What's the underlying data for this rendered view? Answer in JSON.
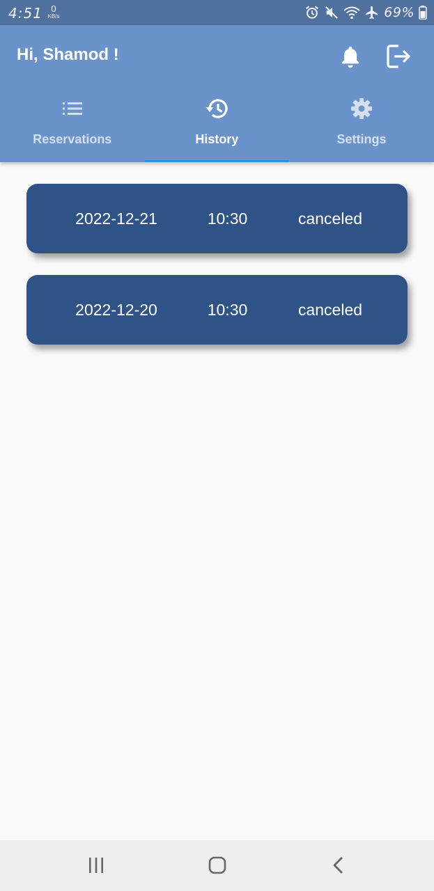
{
  "status_bar": {
    "time": "4:51",
    "net_speed_value": "0",
    "net_speed_unit": "KB/s",
    "battery_percent": "69%",
    "icons": [
      "alarm-icon",
      "mute-icon",
      "wifi-icon",
      "airplane-icon",
      "battery-icon"
    ]
  },
  "header": {
    "greeting": "Hi, Shamod !",
    "actions": [
      "bell-icon",
      "logout-icon"
    ]
  },
  "tabs": [
    {
      "label": "Reservations",
      "icon": "list-icon",
      "active": false
    },
    {
      "label": "History",
      "icon": "history-icon",
      "active": true
    },
    {
      "label": "Settings",
      "icon": "gear-icon",
      "active": false
    }
  ],
  "history": [
    {
      "date": "2022-12-21",
      "time": "10:30",
      "status": "canceled"
    },
    {
      "date": "2022-12-20",
      "time": "10:30",
      "status": "canceled"
    }
  ],
  "nav_bar": {
    "buttons": [
      "recents-icon",
      "home-icon",
      "back-icon"
    ]
  },
  "colors": {
    "status_bar": "#50709e",
    "app_bar": "#6a93cb",
    "card": "#2f5386",
    "tab_indicator": "#2f92e4",
    "background": "#f9f9f9"
  }
}
